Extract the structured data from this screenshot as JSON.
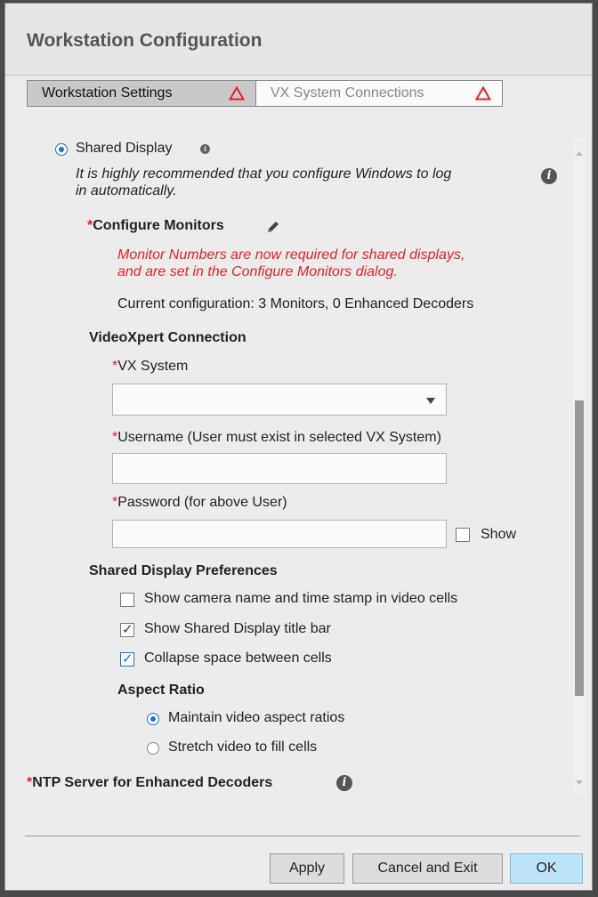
{
  "dialog": {
    "title": "Workstation Configuration"
  },
  "tabs": [
    {
      "label": "Workstation Settings",
      "icon": "warning-triangle-icon",
      "active": true
    },
    {
      "label": "VX System Connections",
      "icon": "warning-triangle-icon",
      "active": false
    }
  ],
  "shared_display": {
    "label": "Shared Display",
    "selected": true,
    "hint_line1": "It is highly recommended that you configure Windows to log",
    "hint_line2": "in automatically."
  },
  "configure_monitors": {
    "required_mark": "*",
    "label": "Configure Monitors",
    "warning_line1": "Monitor Numbers are now required for shared displays,",
    "warning_line2": "and are set in the Configure Monitors dialog.",
    "current_config": "Current configuration: 3 Monitors, 0 Enhanced Decoders"
  },
  "vx_connection": {
    "heading": "VideoXpert Connection",
    "vx_system_label": "VX System",
    "vx_system_value": "",
    "username_label": "Username (User must exist in selected VX System)",
    "username_value": "",
    "password_label": "Password (for above User)",
    "password_value": "",
    "show_label": "Show",
    "required_mark": "*"
  },
  "preferences": {
    "heading": "Shared Display Preferences",
    "options": [
      {
        "label": "Show camera name and time stamp in video cells",
        "checked": false
      },
      {
        "label": "Show Shared Display title bar",
        "checked": true
      },
      {
        "label": "Collapse space between cells",
        "checked": true
      }
    ]
  },
  "aspect_ratio": {
    "heading": "Aspect Ratio",
    "options": [
      {
        "label": "Maintain video aspect ratios",
        "selected": true
      },
      {
        "label": "Stretch video to fill cells",
        "selected": false
      }
    ]
  },
  "ntp": {
    "required_mark": "*",
    "label": "NTP Server for Enhanced Decoders"
  },
  "footer": {
    "apply_label": "Apply",
    "cancel_label": "Cancel and Exit",
    "ok_label": "OK"
  },
  "colors": {
    "required": "#e0202c",
    "accent": "#1e73c8",
    "ok_button": "#bde4f6"
  }
}
